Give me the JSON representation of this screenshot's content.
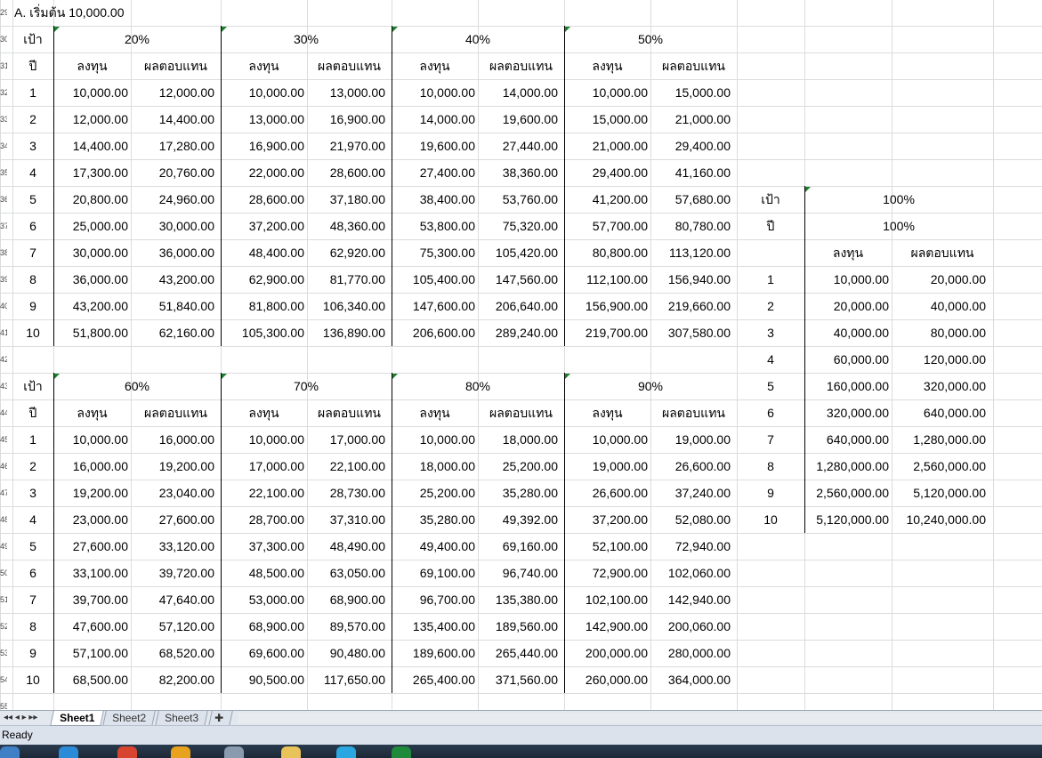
{
  "sheet": {
    "title_cell": "A. เริ่มต้น 10,000.00",
    "row_numbers": [
      "29",
      "30",
      "31",
      "32",
      "33",
      "34",
      "35",
      "36",
      "37",
      "38",
      "39",
      "40",
      "41",
      "42",
      "43",
      "44",
      "45",
      "46",
      "47",
      "48",
      "49",
      "50",
      "51",
      "52",
      "53",
      "54",
      "55"
    ],
    "target_label": "เป้า",
    "year_label": "ปี",
    "invest_label": "ลงทุน",
    "return_label": "ผลตอบแทน",
    "years": [
      "1",
      "2",
      "3",
      "4",
      "5",
      "6",
      "7",
      "8",
      "9",
      "10"
    ],
    "blocks_top": [
      {
        "rate": "20%",
        "invest": [
          "10,000.00",
          "12,000.00",
          "14,400.00",
          "17,300.00",
          "20,800.00",
          "25,000.00",
          "30,000.00",
          "36,000.00",
          "43,200.00",
          "51,800.00"
        ],
        "ret": [
          "12,000.00",
          "14,400.00",
          "17,280.00",
          "20,760.00",
          "24,960.00",
          "30,000.00",
          "36,000.00",
          "43,200.00",
          "51,840.00",
          "62,160.00"
        ]
      },
      {
        "rate": "30%",
        "invest": [
          "10,000.00",
          "13,000.00",
          "16,900.00",
          "22,000.00",
          "28,600.00",
          "37,200.00",
          "48,400.00",
          "62,900.00",
          "81,800.00",
          "105,300.00"
        ],
        "ret": [
          "13,000.00",
          "16,900.00",
          "21,970.00",
          "28,600.00",
          "37,180.00",
          "48,360.00",
          "62,920.00",
          "81,770.00",
          "106,340.00",
          "136,890.00"
        ]
      },
      {
        "rate": "40%",
        "invest": [
          "10,000.00",
          "14,000.00",
          "19,600.00",
          "27,400.00",
          "38,400.00",
          "53,800.00",
          "75,300.00",
          "105,400.00",
          "147,600.00",
          "206,600.00"
        ],
        "ret": [
          "14,000.00",
          "19,600.00",
          "27,440.00",
          "38,360.00",
          "53,760.00",
          "75,320.00",
          "105,420.00",
          "147,560.00",
          "206,640.00",
          "289,240.00"
        ]
      },
      {
        "rate": "50%",
        "invest": [
          "10,000.00",
          "15,000.00",
          "21,000.00",
          "29,400.00",
          "41,200.00",
          "57,700.00",
          "80,800.00",
          "112,100.00",
          "156,900.00",
          "219,700.00"
        ],
        "ret": [
          "15,000.00",
          "21,000.00",
          "29,400.00",
          "41,160.00",
          "57,680.00",
          "80,780.00",
          "113,120.00",
          "156,940.00",
          "219,660.00",
          "307,580.00"
        ]
      }
    ],
    "blocks_bottom": [
      {
        "rate": "60%",
        "invest": [
          "10,000.00",
          "16,000.00",
          "19,200.00",
          "23,000.00",
          "27,600.00",
          "33,100.00",
          "39,700.00",
          "47,600.00",
          "57,100.00",
          "68,500.00"
        ],
        "ret": [
          "16,000.00",
          "19,200.00",
          "23,040.00",
          "27,600.00",
          "33,120.00",
          "39,720.00",
          "47,640.00",
          "57,120.00",
          "68,520.00",
          "82,200.00"
        ]
      },
      {
        "rate": "70%",
        "invest": [
          "10,000.00",
          "17,000.00",
          "22,100.00",
          "28,700.00",
          "37,300.00",
          "48,500.00",
          "53,000.00",
          "68,900.00",
          "69,600.00",
          "90,500.00"
        ],
        "ret": [
          "17,000.00",
          "22,100.00",
          "28,730.00",
          "37,310.00",
          "48,490.00",
          "63,050.00",
          "68,900.00",
          "89,570.00",
          "90,480.00",
          "117,650.00"
        ]
      },
      {
        "rate": "80%",
        "invest": [
          "10,000.00",
          "18,000.00",
          "25,200.00",
          "35,280.00",
          "49,400.00",
          "69,100.00",
          "96,700.00",
          "135,400.00",
          "189,600.00",
          "265,400.00"
        ],
        "ret": [
          "18,000.00",
          "25,200.00",
          "35,280.00",
          "49,392.00",
          "69,160.00",
          "96,740.00",
          "135,380.00",
          "189,560.00",
          "265,440.00",
          "371,560.00"
        ]
      },
      {
        "rate": "90%",
        "invest": [
          "10,000.00",
          "19,000.00",
          "26,600.00",
          "37,200.00",
          "52,100.00",
          "72,900.00",
          "102,100.00",
          "142,900.00",
          "200,000.00",
          "260,000.00"
        ],
        "ret": [
          "19,000.00",
          "26,600.00",
          "37,240.00",
          "52,080.00",
          "72,940.00",
          "102,060.00",
          "142,940.00",
          "200,060.00",
          "280,000.00",
          "364,000.00"
        ]
      }
    ],
    "block_100": {
      "rate": "100%",
      "rate2": "100%",
      "invest": [
        "10,000.00",
        "20,000.00",
        "40,000.00",
        "60,000.00",
        "160,000.00",
        "320,000.00",
        "640,000.00",
        "1,280,000.00",
        "2,560,000.00",
        "5,120,000.00"
      ],
      "ret": [
        "20,000.00",
        "40,000.00",
        "80,000.00",
        "120,000.00",
        "320,000.00",
        "640,000.00",
        "1,280,000.00",
        "2,560,000.00",
        "5,120,000.00",
        "10,240,000.00"
      ]
    }
  },
  "tabs": {
    "nav": "◂◂ ◂ ▸ ▸▸",
    "items": [
      "Sheet1",
      "Sheet2",
      "Sheet3"
    ],
    "active": "Sheet1"
  },
  "status": {
    "text": "Ready"
  },
  "colors": {
    "grid": "#dadcdd",
    "border": "#000000",
    "marker": "#1b7f2a",
    "statusbar": "#dbe2ec"
  }
}
